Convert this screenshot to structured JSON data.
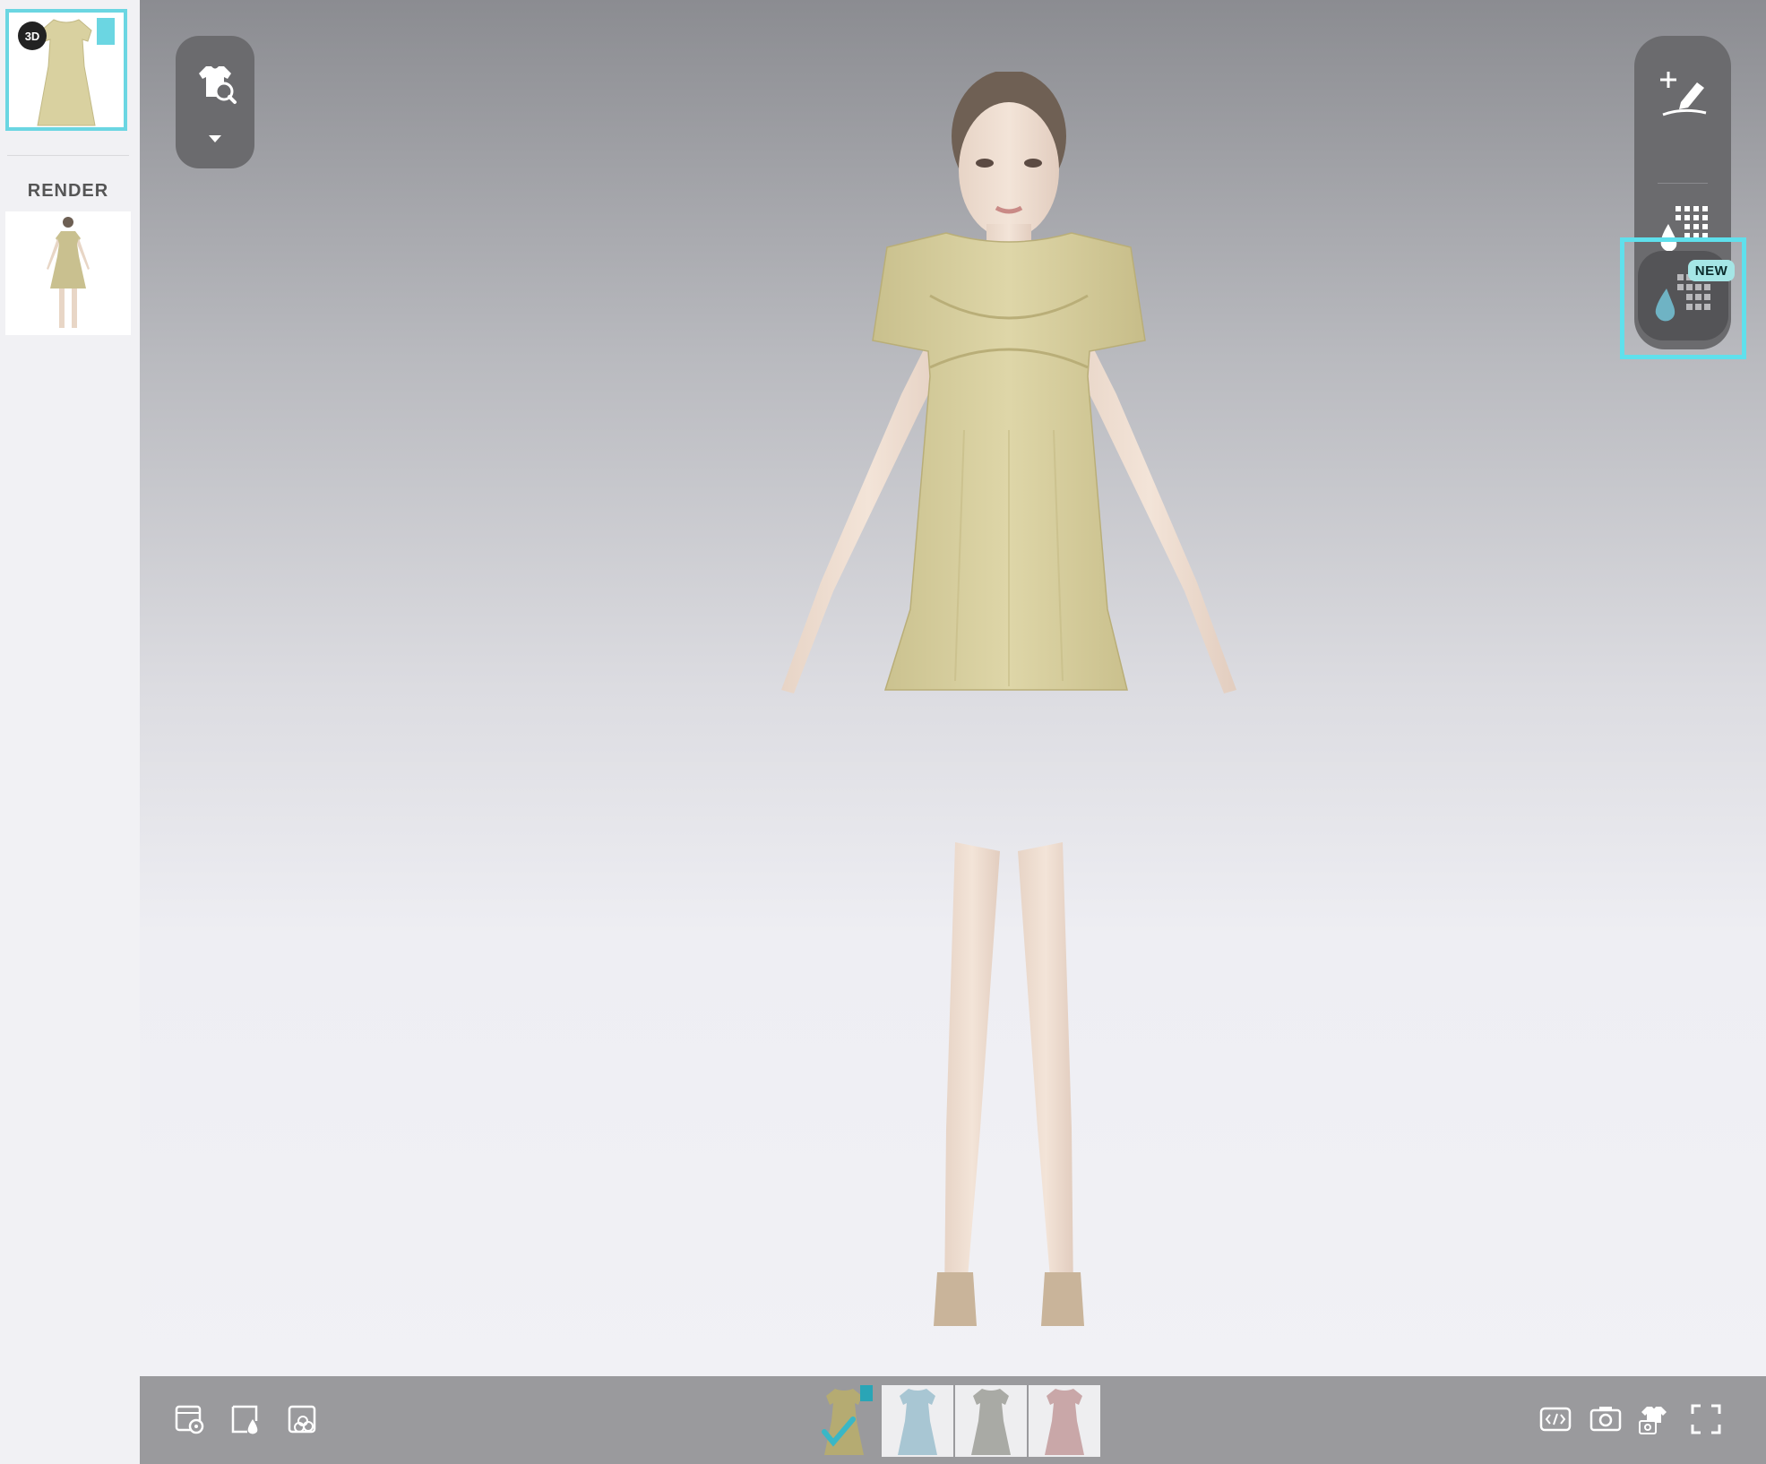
{
  "sidebar": {
    "thumbnail_3d_badge": "3D",
    "render_label": "RENDER"
  },
  "right_toolbar": {
    "new_badge": "NEW"
  },
  "colors": {
    "accent_highlight": "#5fe0ec",
    "toolbar_bg": "#6b6b6e",
    "dress_yellow": "#d9d1a0",
    "dress_blue": "#a8c6d3",
    "dress_gray": "#a9aaa5",
    "dress_pink": "#c9a7a8",
    "selected_check": "#3ab7c6"
  },
  "icons": {
    "top_left": [
      "garment-search-icon",
      "chevron-down-icon"
    ],
    "right_toolbar": [
      "add-annotation-icon",
      "colorway-icon",
      "colorway-new-icon"
    ],
    "bottom_left": [
      "scene-settings-icon",
      "fabric-icon",
      "colorway-compare-icon"
    ],
    "bottom_right": [
      "embed-code-icon",
      "snapshot-icon",
      "avatar-snapshot-icon",
      "fullscreen-icon"
    ]
  },
  "colorways": {
    "selected_index": 0,
    "items": [
      "yellow",
      "blue",
      "gray",
      "pink"
    ]
  }
}
